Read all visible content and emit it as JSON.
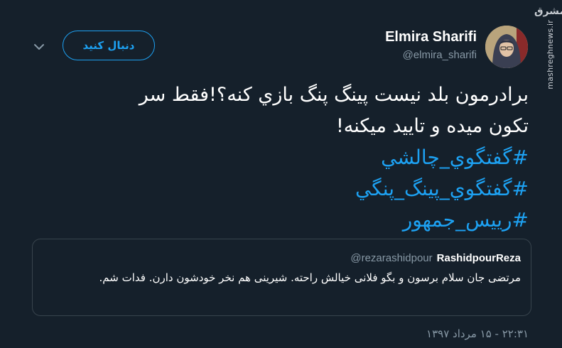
{
  "header": {
    "follow_label": "دنبال کنید",
    "display_name": "Elmira Sharifi",
    "handle": "@elmira_sharifi"
  },
  "watermark": {
    "logo": "مشرق",
    "site": "mashreghnews.ir"
  },
  "tweet": {
    "lines": [
      "برادرمون بلد نيست پينگ پنگ بازي كنه؟!فقط سر",
      "تكون ميده و تاييد ميكنه!"
    ],
    "hashtags": [
      "#گفتگوي_چالشي",
      "#گفتگوي_پينگ_پنگي",
      "#رييس_جمهور"
    ]
  },
  "quoted_tweet": {
    "name": "RashidpourReza",
    "handle": "@rezarashidpour",
    "text": "مرتضی جان سلام برسون و بگو فلانی خیالش راحته. شیرینی هم نخر خودشون دارن. فدات شم."
  },
  "timestamp": "۲۲:۳۱ - ۱۵ مرداد ۱۳۹۷",
  "colors": {
    "background": "#15202b",
    "accent": "#1da1f2",
    "secondary_text": "#8899a6",
    "border": "#38444d"
  },
  "icons": {
    "chevron": "chevron-down-icon",
    "avatar": "avatar"
  }
}
